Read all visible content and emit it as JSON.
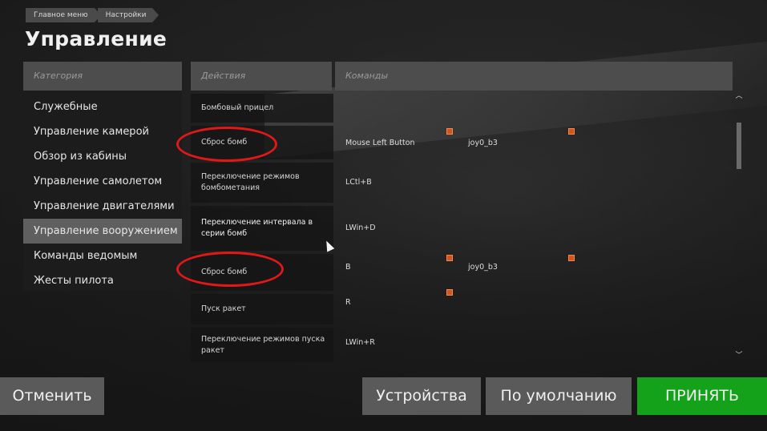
{
  "breadcrumb": [
    "Главное меню",
    "Настройки"
  ],
  "page_title": "Управление",
  "categories": {
    "header": "Категория",
    "items": [
      "Служебные",
      "Управление камерой",
      "Обзор из кабины",
      "Управление самолетом",
      "Управление двигателями",
      "Управление вооружением",
      "Команды ведомым",
      "Жесты пилота"
    ],
    "active": "Управление вооружением"
  },
  "table": {
    "header_actions": "Действия",
    "header_commands": "Команды",
    "rows": [
      {
        "action": "Бомбовый прицел",
        "cmd1": "",
        "cmd2": ""
      },
      {
        "action": "Сброс бомб",
        "cmd1": "Mouse Left Button",
        "cmd2": "joy0_b3"
      },
      {
        "action": "Переключение режимов бомбометания",
        "cmd1": "LCtl+B",
        "cmd2": ""
      },
      {
        "action": "Переключение интервала в серии бомб",
        "cmd1": "LWin+D",
        "cmd2": ""
      },
      {
        "action": "Сброс бомб",
        "cmd1": "B",
        "cmd2": "joy0_b3"
      },
      {
        "action": "Пуск ракет",
        "cmd1": "R",
        "cmd2": ""
      },
      {
        "action": "Переключение режимов пуска ракет",
        "cmd1": "LWin+R",
        "cmd2": ""
      }
    ]
  },
  "buttons": {
    "cancel": "Отменить",
    "devices": "Устройства",
    "defaults": "По умолчанию",
    "accept": "ПРИНЯТЬ"
  },
  "colors": {
    "accept": "#13a21a",
    "highlight_circle": "#e01818",
    "binding_marker": "#d2541e"
  }
}
